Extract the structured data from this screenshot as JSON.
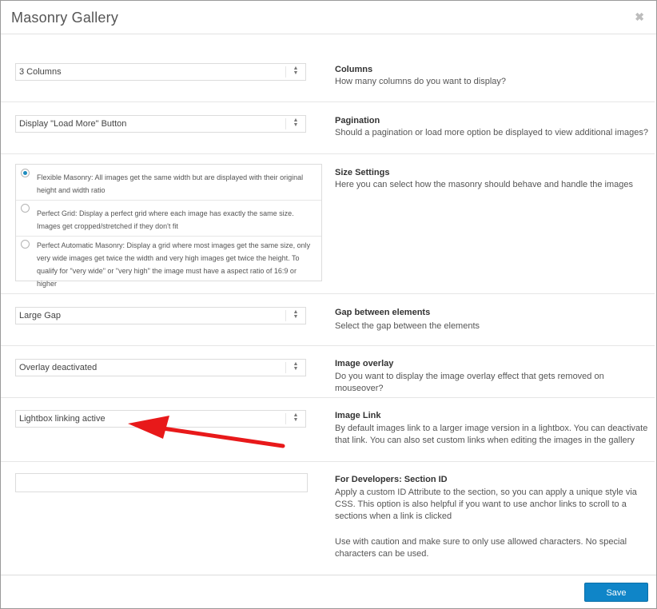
{
  "modal": {
    "title": "Masonry Gallery",
    "close_symbol": "✖"
  },
  "cut_text": "· · · · · · · · · · · · · · · · · · · · · · ·",
  "columns": {
    "value": "3 Columns",
    "label": "Columns",
    "desc": "How many columns do you want to display?"
  },
  "pagination": {
    "value": "Display \"Load More\" Button",
    "label": "Pagination",
    "desc": "Should a pagination or load more option be displayed to view additional images?"
  },
  "size": {
    "label": "Size Settings",
    "desc": "Here you can select how the masonry should behave and handle the images",
    "options": [
      {
        "text": "Flexible Masonry: All images get the same width but are displayed with their original height and width ratio",
        "checked": true
      },
      {
        "text": "Perfect Grid: Display a perfect grid where each image has exactly the same size. Images get cropped/stretched if they don't fit",
        "checked": false
      },
      {
        "text": "Perfect Automatic Masonry: Display a grid where most images get the same size, only very wide images get twice the width and very high images get twice the height. To qualify for \"very wide\" or \"very high\" the image must have a aspect ratio of 16:9 or higher",
        "checked": false
      }
    ]
  },
  "gap": {
    "value": "Large Gap",
    "label": "Gap between elements",
    "desc": "Select the gap between the elements"
  },
  "overlay": {
    "value": "Overlay deactivated",
    "label": "Image overlay",
    "desc": "Do you want to display the image overlay effect that gets removed on mouseover?"
  },
  "link": {
    "value": "Lightbox linking active",
    "label": "Image Link",
    "desc": "By default images link to a larger image version in a lightbox. You can deactivate that link. You can also set custom links when editing the images in the gallery"
  },
  "dev": {
    "label": "For Developers: Section ID",
    "value": "",
    "desc1": "Apply a custom ID Attribute to the section, so you can apply a unique style via CSS. This option is also helpful if you want to use anchor links to scroll to a sections when a link is clicked",
    "desc2": "Use with caution and make sure to only use allowed characters. No special characters can be used."
  },
  "footer": {
    "save_label": "Save"
  },
  "colors": {
    "accent": "#0f85c8",
    "annotation_arrow": "#e8191a"
  }
}
